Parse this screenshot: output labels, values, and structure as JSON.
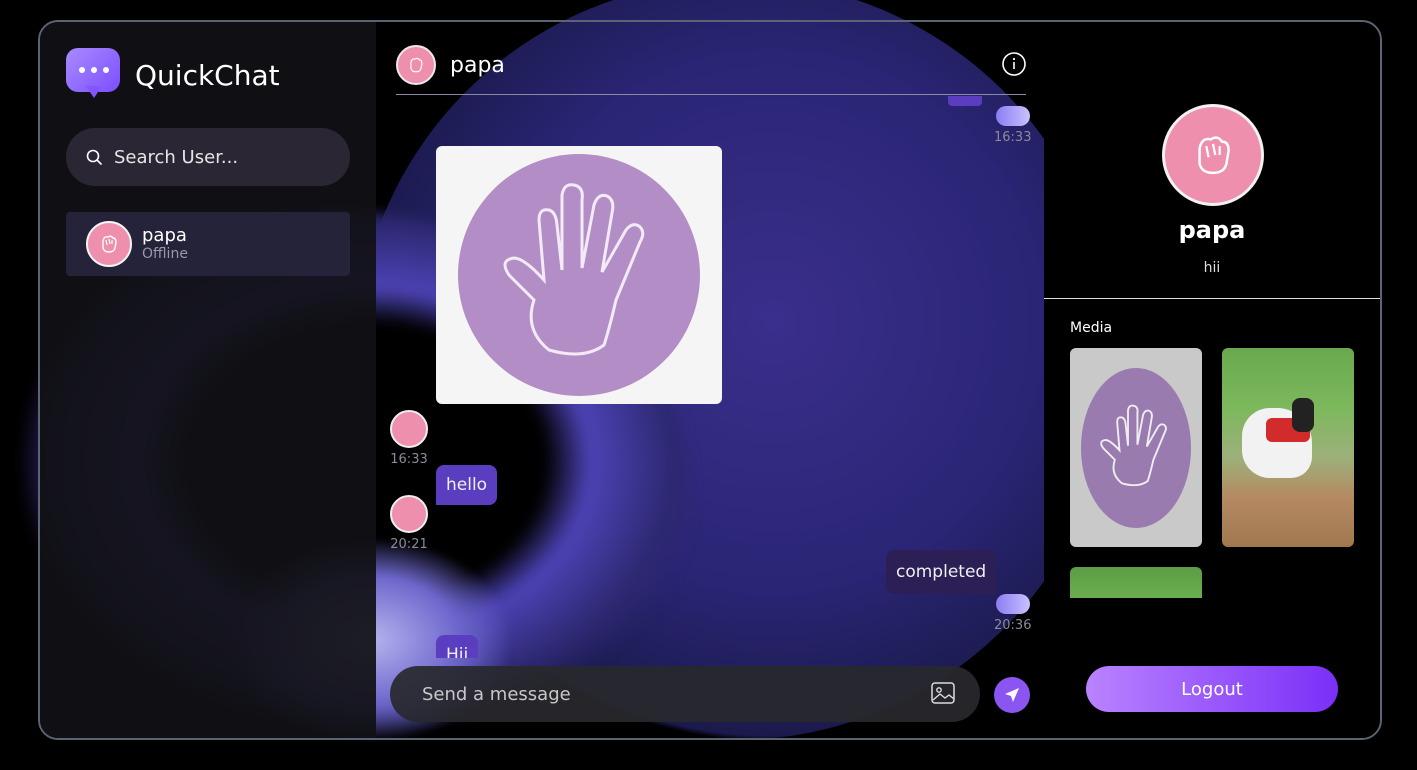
{
  "app": {
    "name": "QuickChat"
  },
  "search": {
    "placeholder": "Search User..."
  },
  "contacts": [
    {
      "name": "papa",
      "status": "Offline"
    }
  ],
  "chat": {
    "title": "papa",
    "messages": [
      {
        "type": "image",
        "from": "peer",
        "time": "16:33"
      },
      {
        "type": "text",
        "from": "peer",
        "text": "hello",
        "time": "20:21"
      },
      {
        "type": "text",
        "from": "me",
        "text": "completed",
        "time": "20:36"
      },
      {
        "type": "text",
        "from": "peer",
        "text": "Hii"
      }
    ],
    "top_time": "16:33",
    "composer_placeholder": "Send a message"
  },
  "profile": {
    "name": "papa",
    "bio": "hii",
    "media_label": "Media"
  },
  "logout_label": "Logout",
  "colors": {
    "accent": "#8a55f0",
    "peer_bubble": "#5b3dc0",
    "own_bubble": "#2b1f55",
    "avatar": "#ee8fae"
  },
  "icons": [
    "chat-logo-icon",
    "search-icon",
    "info-icon",
    "image-attach-icon",
    "send-icon",
    "fist-avatar-icon",
    "hand-icon"
  ]
}
